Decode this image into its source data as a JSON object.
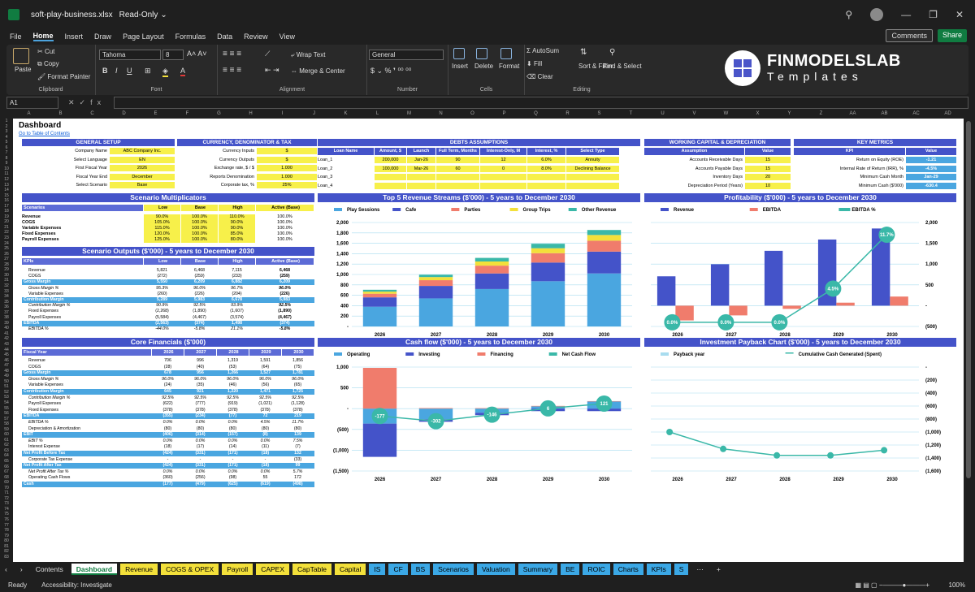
{
  "window": {
    "title": "soft-play-business.xlsx",
    "mode": "Read-Only"
  },
  "menu": [
    "File",
    "Home",
    "Insert",
    "Draw",
    "Page Layout",
    "Formulas",
    "Data",
    "Review",
    "View"
  ],
  "menu_active": "Home",
  "actions": {
    "comments": "Comments",
    "share": "Share"
  },
  "ribbon": {
    "paste": "Paste",
    "cut": "Cut",
    "copy": "Copy",
    "format_painter": "Format Painter",
    "clipboard": "Clipboard",
    "font_name": "Tahoma",
    "font_size": "8",
    "font": "Font",
    "wrap_text": "Wrap Text",
    "merge_center": "Merge & Center",
    "alignment": "Alignment",
    "number_format": "General",
    "number": "Number",
    "insert": "Insert",
    "delete": "Delete",
    "format": "Format",
    "cells": "Cells",
    "autosum": "AutoSum",
    "fill": "Fill",
    "clear": "Clear",
    "sort_filter": "Sort & Filter",
    "find_select": "Find & Select",
    "editing": "Editing"
  },
  "logo": {
    "line1": "FINMODELSLAB",
    "line2": "Templates"
  },
  "namebox": "A1",
  "fx": "fx",
  "columns": [
    "A",
    "B",
    "C",
    "D",
    "E",
    "F",
    "G",
    "H",
    "I",
    "J",
    "K",
    "L",
    "M",
    "N",
    "O",
    "P",
    "Q",
    "R",
    "S",
    "T",
    "U",
    "V",
    "W",
    "X",
    "Y",
    "Z",
    "AA",
    "AB",
    "AC",
    "AD"
  ],
  "sheet": {
    "title": "Dashboard",
    "link": "Go to Table of Contents",
    "general_setup": {
      "header": "GENERAL SETUP",
      "rows": [
        [
          "Company Name",
          "ABC Company Inc."
        ],
        [
          "Select Language",
          "EN"
        ],
        [
          "First Fiscal Year",
          "2026"
        ],
        [
          "Fiscal Year End",
          "December"
        ],
        [
          "Select Scenario",
          "Base"
        ]
      ]
    },
    "currency": {
      "header": "CURRENCY, DENOMINATOR & TAX",
      "rows": [
        [
          "Currency Inputs",
          "$"
        ],
        [
          "Currency Outputs",
          "$"
        ],
        [
          "Exchange rate, $ / $",
          "1.000"
        ],
        [
          "Reports Denomination",
          "1.000"
        ],
        [
          "Corporate tax, %",
          "25%"
        ]
      ]
    },
    "debts": {
      "header": "DEBTS ASSUMPTIONS",
      "cols": [
        "Loan Name",
        "Amount, $",
        "Launch",
        "Full Term, Months",
        "Interest-Only, M",
        "Interest, %",
        "Select Type"
      ],
      "rows": [
        [
          "Loan_1",
          "200,000",
          "Jan-26",
          "90",
          "12",
          "6.0%",
          "Annuity"
        ],
        [
          "Loan_2",
          "100,000",
          "Mar-26",
          "60",
          "0",
          "8.0%",
          "Declining Balance"
        ],
        [
          "Loan_3",
          "",
          "",
          "",
          "",
          "",
          ""
        ],
        [
          "Loan_4",
          "",
          "",
          "",
          "",
          "",
          ""
        ]
      ]
    },
    "working_capital": {
      "header": "WORKING CAPITAL & DEPRECIATION",
      "cols": [
        "Assumption",
        "Value"
      ],
      "rows": [
        [
          "Accounts Receivable Days",
          "15"
        ],
        [
          "Accounts Payable Days",
          "15"
        ],
        [
          "Inventory Days",
          "20"
        ],
        [
          "Depreciation Period (Years)",
          "10"
        ]
      ]
    },
    "key_metrics": {
      "header": "KEY METRICS",
      "cols": [
        "KPI",
        "Value"
      ],
      "rows": [
        [
          "Return on Equity (ROE)",
          "-1.21"
        ],
        [
          "Internal Rate of Return (IRR), %",
          "-4.5%"
        ],
        [
          "Minimum Cash Month",
          "Jan-29"
        ],
        [
          "Minimum Cash ($'000)",
          "-630.4"
        ]
      ]
    },
    "scenario_mult": {
      "header": "Scenario Multiplicators",
      "cols": [
        "Scenarios",
        "Low",
        "Base",
        "High",
        "Active (Base)"
      ],
      "rows": [
        [
          "Revenue",
          "90.0%",
          "100.0%",
          "110.0%",
          "100.0%"
        ],
        [
          "COGS",
          "105.0%",
          "100.0%",
          "90.0%",
          "100.0%"
        ],
        [
          "Variable Expenses",
          "115.0%",
          "100.0%",
          "90.0%",
          "100.0%"
        ],
        [
          "Fixed Expenses",
          "120.0%",
          "100.0%",
          "85.0%",
          "100.0%"
        ],
        [
          "Payroll Expenses",
          "125.0%",
          "100.0%",
          "80.0%",
          "100.0%"
        ]
      ]
    },
    "scenario_out": {
      "header": "Scenario Outputs ($'000) - 5 years to December 2030",
      "cols": [
        "KPIs",
        "Low",
        "Base",
        "High",
        "Active (Base)"
      ],
      "rows": [
        [
          "Revenue",
          "5,821",
          "6,468",
          "7,115",
          "6,468",
          "n"
        ],
        [
          "COGS",
          "(272)",
          "(259)",
          "(233)",
          "(259)",
          "n"
        ],
        [
          "Gross Margin",
          "5,550",
          "6,209",
          "6,882",
          "6,209",
          "h"
        ],
        [
          "Gross Margin %",
          "95.3%",
          "96.0%",
          "96.7%",
          "96.0%",
          "i"
        ],
        [
          "Variable Expenses",
          "(260)",
          "(226)",
          "(204)",
          "(226)",
          "n"
        ],
        [
          "Contribution Margin",
          "5,289",
          "5,983",
          "6,678",
          "5,983",
          "h"
        ],
        [
          "Contribution Margin %",
          "90.9%",
          "92.5%",
          "93.9%",
          "92.5%",
          "i"
        ],
        [
          "Fixed Expenses",
          "(2,268)",
          "(1,890)",
          "(1,607)",
          "(1,890)",
          "n"
        ],
        [
          "Payroll Expenses",
          "(5,584)",
          "(4,467)",
          "(3,574)",
          "(4,467)",
          "n"
        ],
        [
          "EBITDA",
          "(2,563)",
          "(374)",
          "1,498",
          "(374)",
          "h"
        ],
        [
          "EBITDA %",
          "-44.0%",
          "-5.8%",
          "21.1%",
          "-5.8%",
          "i"
        ]
      ]
    },
    "core": {
      "header": "Core Financials ($'000)",
      "cols": [
        "Fiscal Year",
        "2026",
        "2027",
        "2028",
        "2029",
        "2030"
      ],
      "rows": [
        [
          "Revenue",
          "706",
          "996",
          "1,319",
          "1,591",
          "1,856",
          "n"
        ],
        [
          "COGS",
          "(28)",
          "(40)",
          "(53)",
          "(64)",
          "(75)",
          "n"
        ],
        [
          "Gross Margin",
          "678",
          "956",
          "1,266",
          "1,527",
          "1,781",
          "h"
        ],
        [
          "Gross Margin %",
          "96.0%",
          "96.0%",
          "96.0%",
          "96.0%",
          "96.0%",
          "i"
        ],
        [
          "Variable Expenses",
          "(24)",
          "(35)",
          "(46)",
          "(56)",
          "(65)",
          "n"
        ],
        [
          "Contribution Margin",
          "645",
          "921",
          "1,220",
          "1,471",
          "1,725",
          "h"
        ],
        [
          "Contribution Margin %",
          "92.5%",
          "92.5%",
          "92.5%",
          "92.5%",
          "92.5%",
          "i"
        ],
        [
          "Payroll Expenses",
          "(622)",
          "(777)",
          "(919)",
          "(1,021)",
          "(1,128)",
          "n"
        ],
        [
          "Fixed Expenses",
          "(378)",
          "(378)",
          "(378)",
          "(378)",
          "(378)",
          "n"
        ],
        [
          "EBITDA",
          "(355)",
          "(234)",
          "(77)",
          "72",
          "219",
          "h"
        ],
        [
          "EBITDA %",
          "0.0%",
          "0.0%",
          "0.0%",
          "4.5%",
          "11.7%",
          "i"
        ],
        [
          "Depreciation & Amortization",
          "(80)",
          "(80)",
          "(80)",
          "(80)",
          "(80)",
          "n"
        ],
        [
          "EBIT",
          "(406)",
          "(314)",
          "(157)",
          "(8)",
          "139",
          "h"
        ],
        [
          "EBIT %",
          "0.0%",
          "0.0%",
          "0.0%",
          "0.0%",
          "7.5%",
          "i"
        ],
        [
          "Interest Expense",
          "(18)",
          "(17)",
          "(14)",
          "(11)",
          "(7)",
          "n"
        ],
        [
          "Net Profit Before Tax",
          "(424)",
          "(331)",
          "(171)",
          "(18)",
          "132",
          "h"
        ],
        [
          "Corporate Tax Expense",
          "-",
          "-",
          "-",
          "-",
          "(33)",
          "n"
        ],
        [
          "Net Profit After Tax",
          "(424)",
          "(331)",
          "(171)",
          "(18)",
          "99",
          "h"
        ],
        [
          "Net Profit After Tax %",
          "0.0%",
          "0.0%",
          "0.0%",
          "0.0%",
          "5.7%",
          "i"
        ],
        [
          "Operating Cash Flows",
          "(360)",
          "(256)",
          "(98)",
          "55",
          "172",
          "n"
        ],
        [
          "Cash",
          "(177)",
          "(479)",
          "(625)",
          "(619)",
          "(498)",
          "h"
        ]
      ]
    }
  },
  "charts": {
    "revenue": {
      "title": "Top 5 Revenue Streams ($'000) - 5 years to December 2030",
      "legend": [
        "Play Sessions",
        "Cafe",
        "Parties",
        "Group Trips",
        "Other Revenue"
      ],
      "colors": [
        "#4aa6e0",
        "#4453c9",
        "#f07c6c",
        "#f3e03a",
        "#3ab8a8"
      ],
      "yticks": [
        "-",
        "200",
        "400",
        "600",
        "800",
        "1,000",
        "1,200",
        "1,400",
        "1,600",
        "1,800",
        "2,000"
      ]
    },
    "profitability": {
      "title": "Profitability ($'000) - 5 years to December 2030",
      "legend": [
        "Revenue",
        "EBITDA",
        "EBITDA %"
      ],
      "colors": [
        "#4453c9",
        "#f07c6c",
        "#3ab8a8"
      ],
      "yticks": [
        "(500)",
        "-",
        "500",
        "1,000",
        "1,500",
        "2,000"
      ],
      "labels": [
        "0.0%",
        "0.0%",
        "0.0%",
        "4.5%",
        "11.7%"
      ]
    },
    "cashflow": {
      "title": "Cash flow ($'000) - 5 years to December 2030",
      "legend": [
        "Operating",
        "Investing",
        "Financing",
        "Net Cash Flow"
      ],
      "colors": [
        "#4aa6e0",
        "#4453c9",
        "#f07c6c",
        "#3ab8a8"
      ],
      "yticks": [
        "(1,500)",
        "(1,000)",
        "(500)",
        "-",
        "500",
        "1,000"
      ],
      "labels": [
        "-177",
        "-302",
        "-146",
        "6",
        "121"
      ]
    },
    "payback": {
      "title": "Investment Payback Chart ($'000) - 5 years to December 2030",
      "legend": [
        "Payback year",
        "Cumulative Cash Generated (Spent)"
      ],
      "colors": [
        "#a8dcef",
        "#3ab8a8"
      ],
      "yticks": [
        "(1,600)",
        "(1,400)",
        "(1,200)",
        "(1,000)",
        "(800)",
        "(600)",
        "(400)",
        "(200)",
        "-"
      ]
    }
  },
  "chart_data": [
    {
      "type": "bar",
      "title": "Top 5 Revenue Streams ($'000) - 5 years to December 2030",
      "categories": [
        "2026",
        "2027",
        "2028",
        "2029",
        "2030"
      ],
      "ylim": [
        0,
        2000
      ],
      "series": [
        {
          "name": "Play Sessions",
          "values": [
            380,
            540,
            720,
            870,
            1020
          ]
        },
        {
          "name": "Cafe",
          "values": [
            180,
            240,
            300,
            360,
            420
          ]
        },
        {
          "name": "Parties",
          "values": [
            70,
            110,
            150,
            180,
            210
          ]
        },
        {
          "name": "Group Trips",
          "values": [
            40,
            60,
            80,
            95,
            110
          ]
        },
        {
          "name": "Other Revenue",
          "values": [
            36,
            46,
            69,
            86,
            96
          ]
        }
      ]
    },
    {
      "type": "bar",
      "title": "Profitability ($'000) - 5 years to December 2030",
      "categories": [
        "2026",
        "2027",
        "2028",
        "2029",
        "2030"
      ],
      "ylim": [
        -500,
        2000
      ],
      "series": [
        {
          "name": "Revenue",
          "values": [
            706,
            996,
            1319,
            1591,
            1856
          ]
        },
        {
          "name": "EBITDA",
          "values": [
            -355,
            -234,
            -77,
            72,
            219
          ]
        },
        {
          "name": "EBITDA %",
          "values": [
            0,
            0,
            0,
            4.5,
            11.7
          ]
        }
      ]
    },
    {
      "type": "bar",
      "title": "Cash flow ($'000) - 5 years to December 2030",
      "categories": [
        "2026",
        "2027",
        "2028",
        "2029",
        "2030"
      ],
      "ylim": [
        -1500,
        1000
      ],
      "series": [
        {
          "name": "Operating",
          "values": [
            -360,
            -256,
            -98,
            55,
            172
          ]
        },
        {
          "name": "Investing",
          "values": [
            -800,
            -60,
            -60,
            -60,
            -60
          ]
        },
        {
          "name": "Financing",
          "values": [
            980,
            14,
            12,
            11,
            9
          ]
        },
        {
          "name": "Net Cash Flow",
          "values": [
            -177,
            -302,
            -146,
            6,
            121
          ]
        }
      ]
    },
    {
      "type": "line",
      "title": "Investment Payback Chart ($'000) - 5 years to December 2030",
      "categories": [
        "2026",
        "2027",
        "2028",
        "2029",
        "2030"
      ],
      "ylim": [
        -1600,
        0
      ],
      "series": [
        {
          "name": "Cumulative Cash Generated (Spent)",
          "values": [
            -1000,
            -1260,
            -1360,
            -1360,
            -1280
          ]
        }
      ]
    }
  ],
  "tabs": [
    {
      "label": "Contents",
      "style": "plain"
    },
    {
      "label": "Dashboard",
      "style": "active"
    },
    {
      "label": "Revenue",
      "style": "y"
    },
    {
      "label": "COGS & OPEX",
      "style": "y"
    },
    {
      "label": "Payroll",
      "style": "y"
    },
    {
      "label": "CAPEX",
      "style": "y"
    },
    {
      "label": "CapTable",
      "style": "y"
    },
    {
      "label": "Capital",
      "style": "y"
    },
    {
      "label": "IS",
      "style": "b"
    },
    {
      "label": "CF",
      "style": "b"
    },
    {
      "label": "BS",
      "style": "b"
    },
    {
      "label": "Scenarios",
      "style": "b"
    },
    {
      "label": "Valuation",
      "style": "b"
    },
    {
      "label": "Summary",
      "style": "b"
    },
    {
      "label": "BE",
      "style": "b"
    },
    {
      "label": "ROIC",
      "style": "b"
    },
    {
      "label": "Charts",
      "style": "b"
    },
    {
      "label": "KPIs",
      "style": "b"
    },
    {
      "label": "S",
      "style": "b"
    }
  ],
  "status": {
    "ready": "Ready",
    "accessibility": "Accessibility: Investigate",
    "zoom": "100%"
  }
}
